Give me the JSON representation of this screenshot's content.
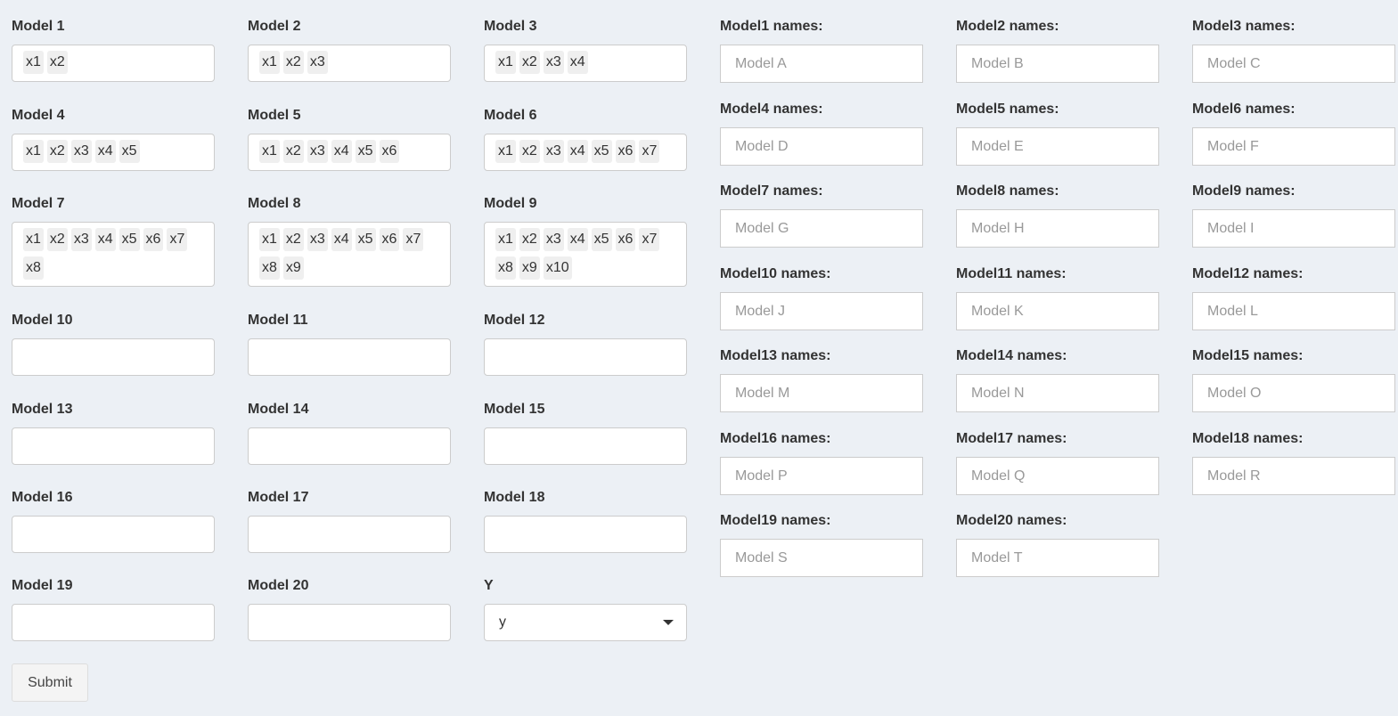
{
  "models": [
    {
      "label": "Model 1",
      "chips": [
        "x1",
        "x2"
      ]
    },
    {
      "label": "Model 2",
      "chips": [
        "x1",
        "x2",
        "x3"
      ]
    },
    {
      "label": "Model 3",
      "chips": [
        "x1",
        "x2",
        "x3",
        "x4"
      ]
    },
    {
      "label": "Model 4",
      "chips": [
        "x1",
        "x2",
        "x3",
        "x4",
        "x5"
      ]
    },
    {
      "label": "Model 5",
      "chips": [
        "x1",
        "x2",
        "x3",
        "x4",
        "x5",
        "x6"
      ]
    },
    {
      "label": "Model 6",
      "chips": [
        "x1",
        "x2",
        "x3",
        "x4",
        "x5",
        "x6",
        "x7"
      ]
    },
    {
      "label": "Model 7",
      "chips": [
        "x1",
        "x2",
        "x3",
        "x4",
        "x5",
        "x6",
        "x7",
        "x8"
      ]
    },
    {
      "label": "Model 8",
      "chips": [
        "x1",
        "x2",
        "x3",
        "x4",
        "x5",
        "x6",
        "x7",
        "x8",
        "x9"
      ]
    },
    {
      "label": "Model 9",
      "chips": [
        "x1",
        "x2",
        "x3",
        "x4",
        "x5",
        "x6",
        "x7",
        "x8",
        "x9",
        "x10"
      ]
    },
    {
      "label": "Model 10",
      "chips": []
    },
    {
      "label": "Model 11",
      "chips": []
    },
    {
      "label": "Model 12",
      "chips": []
    },
    {
      "label": "Model 13",
      "chips": []
    },
    {
      "label": "Model 14",
      "chips": []
    },
    {
      "label": "Model 15",
      "chips": []
    },
    {
      "label": "Model 16",
      "chips": []
    },
    {
      "label": "Model 17",
      "chips": []
    },
    {
      "label": "Model 18",
      "chips": []
    },
    {
      "label": "Model 19",
      "chips": []
    },
    {
      "label": "Model 20",
      "chips": []
    }
  ],
  "y_select": {
    "label": "Y",
    "value": "y"
  },
  "names": [
    {
      "label": "Model1 names:",
      "placeholder": "Model A"
    },
    {
      "label": "Model2 names:",
      "placeholder": "Model B"
    },
    {
      "label": "Model3 names:",
      "placeholder": "Model C"
    },
    {
      "label": "Model4 names:",
      "placeholder": "Model D"
    },
    {
      "label": "Model5 names:",
      "placeholder": "Model E"
    },
    {
      "label": "Model6 names:",
      "placeholder": "Model F"
    },
    {
      "label": "Model7 names:",
      "placeholder": "Model G"
    },
    {
      "label": "Model8 names:",
      "placeholder": "Model H"
    },
    {
      "label": "Model9 names:",
      "placeholder": "Model I"
    },
    {
      "label": "Model10 names:",
      "placeholder": "Model J"
    },
    {
      "label": "Model11 names:",
      "placeholder": "Model K"
    },
    {
      "label": "Model12 names:",
      "placeholder": "Model L"
    },
    {
      "label": "Model13 names:",
      "placeholder": "Model M"
    },
    {
      "label": "Model14 names:",
      "placeholder": "Model N"
    },
    {
      "label": "Model15 names:",
      "placeholder": "Model O"
    },
    {
      "label": "Model16 names:",
      "placeholder": "Model P"
    },
    {
      "label": "Model17 names:",
      "placeholder": "Model Q"
    },
    {
      "label": "Model18 names:",
      "placeholder": "Model R"
    },
    {
      "label": "Model19 names:",
      "placeholder": "Model S"
    },
    {
      "label": "Model20 names:",
      "placeholder": "Model T"
    }
  ],
  "submit_label": "Submit",
  "colors": {
    "background": "#ecf0f5",
    "input_border": "#cccccc",
    "chip_background": "#efefef"
  }
}
